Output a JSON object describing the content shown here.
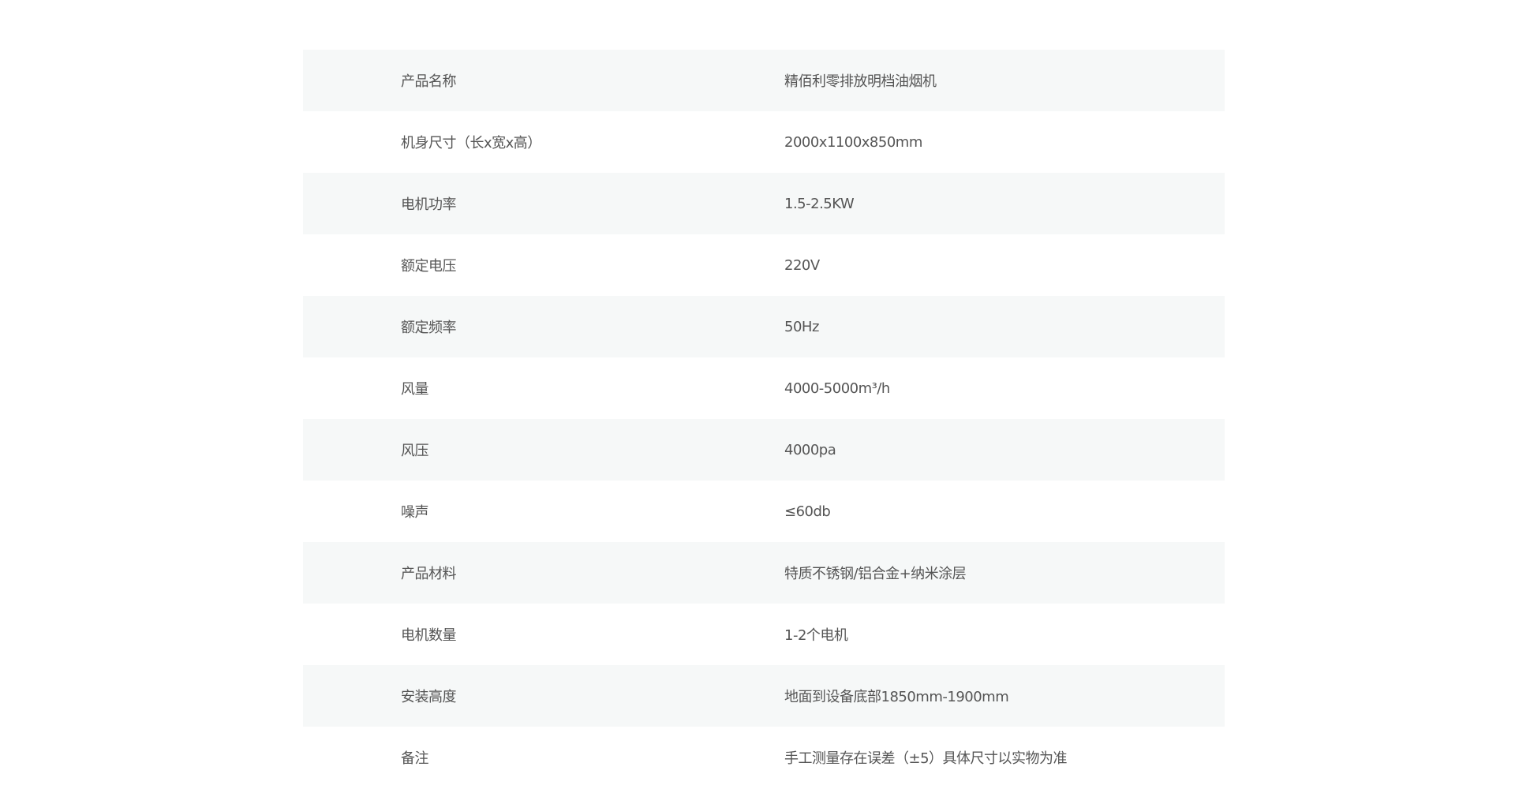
{
  "specs": [
    {
      "label": "产品名称",
      "value": "精佰利零排放明档油烟机"
    },
    {
      "label": "机身尺寸（长x宽x高）",
      "value": "2000x1100x850mm"
    },
    {
      "label": "电机功率",
      "value": "1.5-2.5KW"
    },
    {
      "label": "额定电压",
      "value": "220V"
    },
    {
      "label": "额定频率",
      "value": "50Hz"
    },
    {
      "label": "风量",
      "value": "4000-5000m³/h"
    },
    {
      "label": "风压",
      "value": "4000pa"
    },
    {
      "label": "噪声",
      "value": "≤60db"
    },
    {
      "label": "产品材料",
      "value": "特质不锈钢/铝合金+纳米涂层"
    },
    {
      "label": "电机数量",
      "value": "1-2个电机"
    },
    {
      "label": "安装高度",
      "value": "地面到设备底部1850mm-1900mm"
    },
    {
      "label": "备注",
      "value": "手工测量存在误差（±5）具体尺寸以实物为准"
    }
  ]
}
